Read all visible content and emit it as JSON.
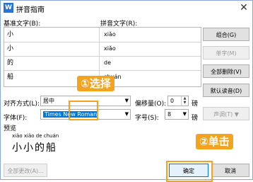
{
  "dialog": {
    "title": "拼音指南",
    "close_glyph": "✕"
  },
  "headers": {
    "base": "基准文字(B):",
    "pinyin": "拼音文字(R):"
  },
  "rows": [
    {
      "base": "小",
      "pinyin": "xiǎo"
    },
    {
      "base": "小",
      "pinyin": "xiǎo"
    },
    {
      "base": "的",
      "pinyin": "de"
    },
    {
      "base": "船",
      "pinyin": "chuán"
    }
  ],
  "buttons": {
    "combine": "组合(G)",
    "single": "单字(M)",
    "clear_all": "全部删除(V)",
    "default_reading": "默认读音(D)",
    "sound": "声调(T)",
    "apply_all": "全部更改(A)...",
    "ok": "确定",
    "cancel": "取消"
  },
  "alignment": {
    "label": "对齐方式(L):",
    "value": "居中"
  },
  "offset": {
    "label": "偏移量(O):",
    "value": "0",
    "unit": "磅"
  },
  "font": {
    "label": "字体(F):",
    "value": "Times New Roman"
  },
  "size": {
    "label": "字号(S):",
    "value": "8",
    "unit": "磅"
  },
  "preview": {
    "label": "预览",
    "pinyin": "xiǎo xiǎo  de  chuán",
    "text": "小小的船"
  },
  "annotations": {
    "select": "①选择",
    "click": "②单击"
  }
}
